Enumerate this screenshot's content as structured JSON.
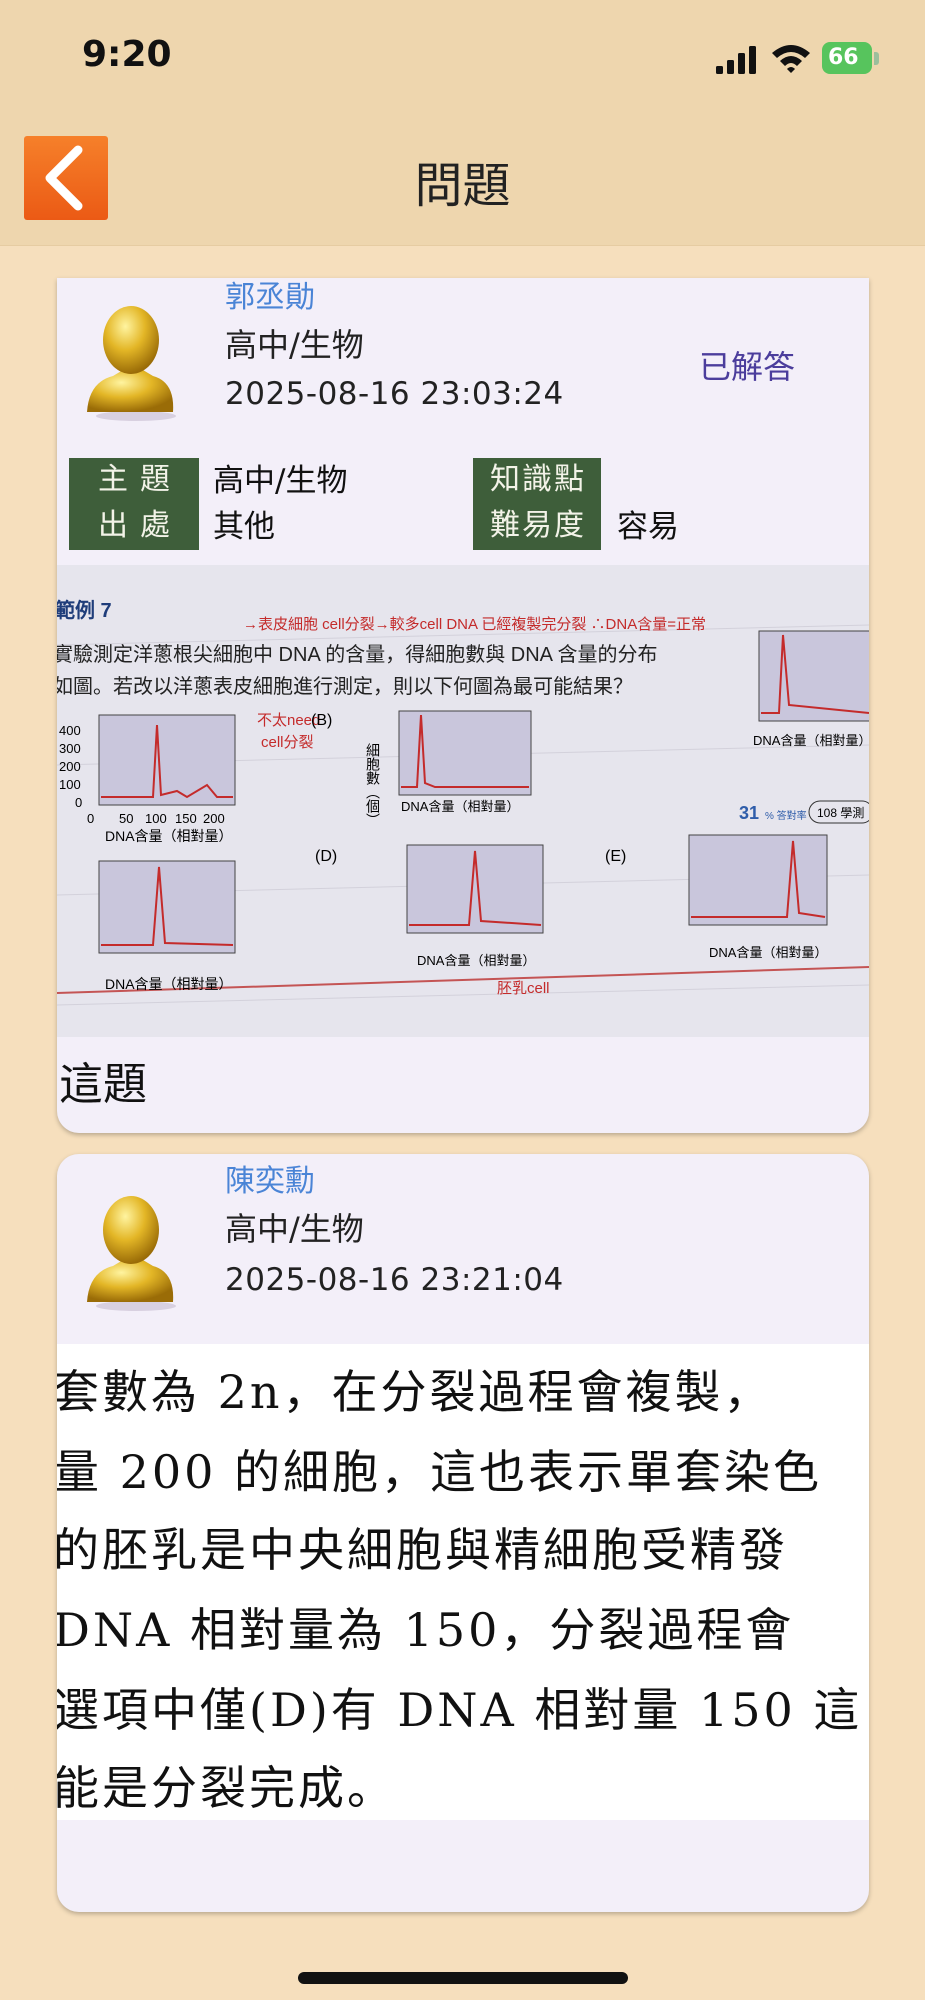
{
  "status_bar": {
    "time": "9:20",
    "battery": "66",
    "icons": [
      "signal-icon",
      "wifi-icon",
      "battery-icon"
    ]
  },
  "nav": {
    "title": "問題",
    "back_icon": "chevron-left-icon"
  },
  "colors": {
    "background": "#F6DFBD",
    "nav_background": "#EED6AE",
    "back_button": "#EB5A15",
    "card_background": "#F3EFF9",
    "label_green": "#3E5E3A",
    "username_blue": "#4A84D6",
    "answered_purple": "#4B3D9C"
  },
  "question": {
    "user_name": "郭丞勛",
    "subject": "高中/生物",
    "timestamp": "2025-08-16 23:03:24",
    "status": "已解答",
    "meta": {
      "topic_label": "主題",
      "topic_value": "高中/生物",
      "source_label": "出處",
      "source_value": "其他",
      "knowledge_label": "知識點",
      "knowledge_value": "",
      "difficulty_label": "難易度",
      "difficulty_value": "容易"
    },
    "image": {
      "example_label": "範例 7",
      "question_line_1": "實驗測定洋蔥根尖細胞中 DNA 的含量，得細胞數與 DNA 含量的分布",
      "question_line_2": "如圖。若改以洋蔥表皮細胞進行測定，則以下何圖為最可能結果？",
      "y_axis_label": "細胞數（個）",
      "x_axis_label": "DNA含量（相對量）",
      "y_ticks": [
        "400",
        "300",
        "200",
        "100",
        "0"
      ],
      "x_ticks": [
        "0",
        "50",
        "100",
        "150",
        "200"
      ],
      "option_b": "(B)",
      "option_d": "(D)",
      "option_e": "(E)",
      "correct_rate": "31",
      "correct_rate_suffix": "% 答對率",
      "exam_tag": "108 學測",
      "note_1": "不太need",
      "note_2": "cell分裂",
      "note_3": "胚乳cell",
      "note_top": "→表皮細胞 cell分裂→較多cell DNA 已經複製完分裂 ∴DNA含量=正常"
    },
    "text": "這題"
  },
  "answer": {
    "user_name": "陳奕勳",
    "subject": "高中/生物",
    "timestamp": "2025-08-16 23:21:04",
    "lines": [
      "套數為 2n，在分裂過程會複製，",
      "量 200 的細胞，這也表示單套染色",
      "的胚乳是中央細胞與精細胞受精發",
      " DNA 相對量為 150，分裂過程會",
      "選項中僅(D)有 DNA 相對量 150 這",
      "能是分裂完成。"
    ]
  }
}
